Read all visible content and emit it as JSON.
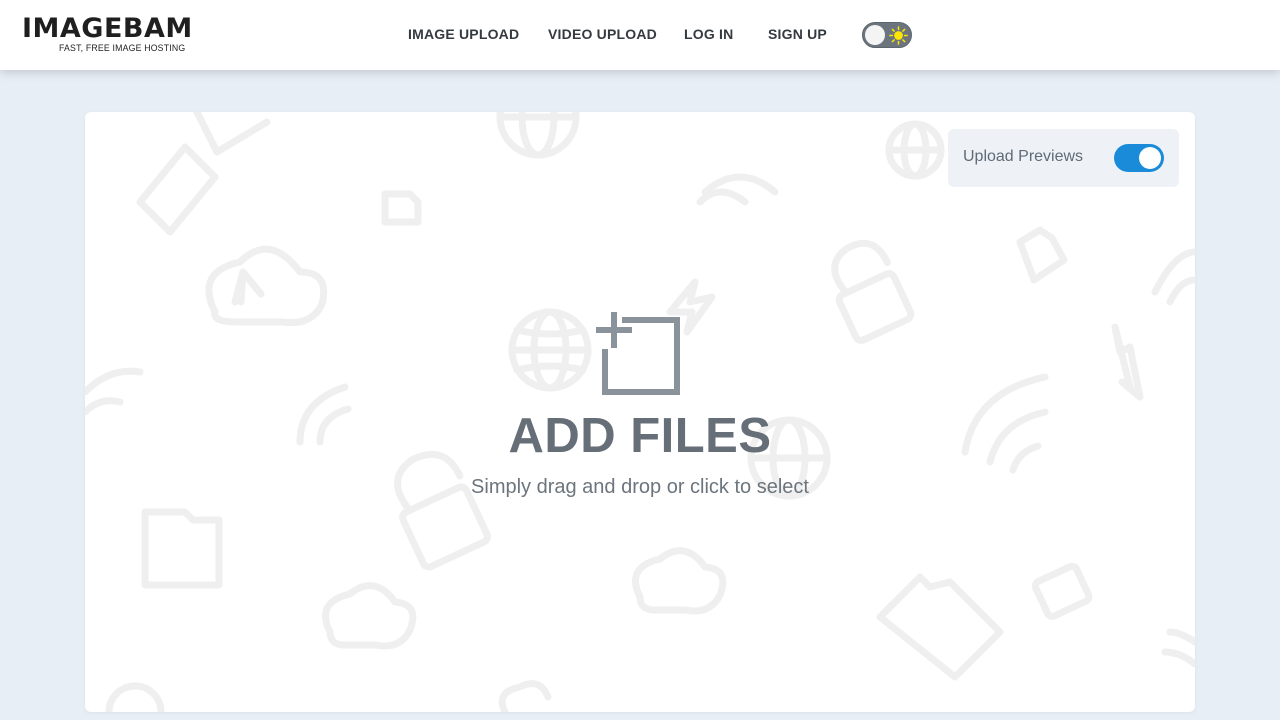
{
  "brand": {
    "name": "IMAGEBAM",
    "tagline": "FAST, FREE IMAGE HOSTING"
  },
  "nav": {
    "items": [
      {
        "label": "IMAGE UPLOAD"
      },
      {
        "label": "VIDEO UPLOAD"
      },
      {
        "label": "LOG IN"
      },
      {
        "label": "SIGN UP"
      }
    ],
    "theme_toggle": {
      "state": "light",
      "icon": "sun-icon"
    }
  },
  "upload": {
    "title": "ADD FILES",
    "subtitle": "Simply drag and drop or click to select",
    "icon": "add-file-icon",
    "previews_label": "Upload Previews",
    "previews_enabled": true
  },
  "colors": {
    "page_bg": "#e8eef6",
    "accent": "#1a8bd8",
    "text_muted": "#666f78",
    "sun": "#ffe600"
  }
}
